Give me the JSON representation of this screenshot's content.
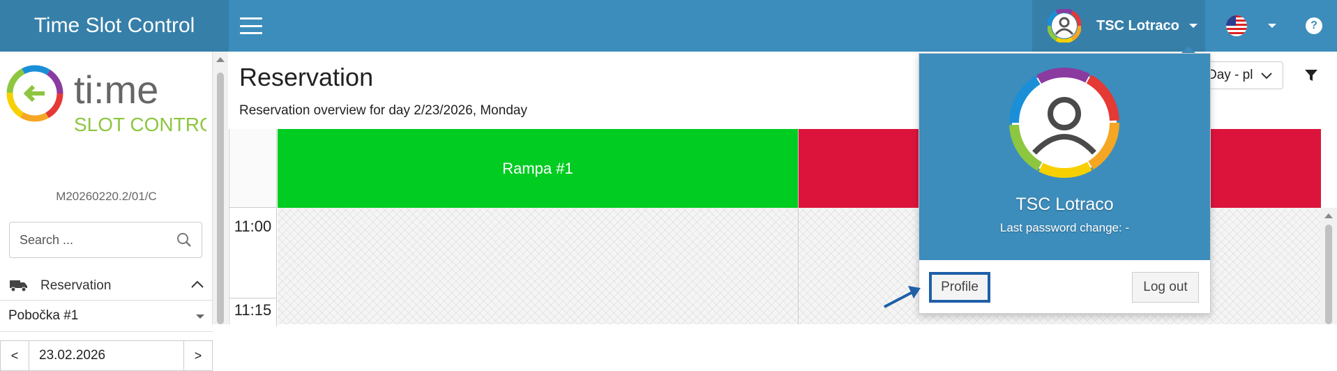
{
  "header": {
    "app_title": "Time Slot Control",
    "user_name": "TSC Lotraco",
    "language_flag": "us-flag-icon",
    "help_label": "?"
  },
  "sidebar": {
    "logo_text_main": "ti:me",
    "logo_text_sub": "SLOT CONTROL",
    "version": "M20260220.2/01/C",
    "search_placeholder": "Search ...",
    "nav_reservation": "Reservation",
    "branch": "Pobočka #1",
    "date_prev": "<",
    "date_value": "23.02.2026",
    "date_next": ">"
  },
  "main": {
    "title": "Reservation",
    "subtitle": "Reservation overview for day 2/23/2026, Monday",
    "view_select": "Day - pl",
    "columns": [
      {
        "label": "Rampa #1",
        "color": "#00cc22"
      },
      {
        "label": "",
        "color": "#dc143c"
      }
    ],
    "times": [
      "11:00",
      "11:15"
    ]
  },
  "user_dropdown": {
    "name": "TSC Lotraco",
    "password_change": "Last password change: -",
    "profile_label": "Profile",
    "logout_label": "Log out"
  },
  "colors": {
    "header_bg": "#3c8dbc",
    "header_dark": "#367fa9",
    "accent_annotation": "#1f5fa8"
  }
}
